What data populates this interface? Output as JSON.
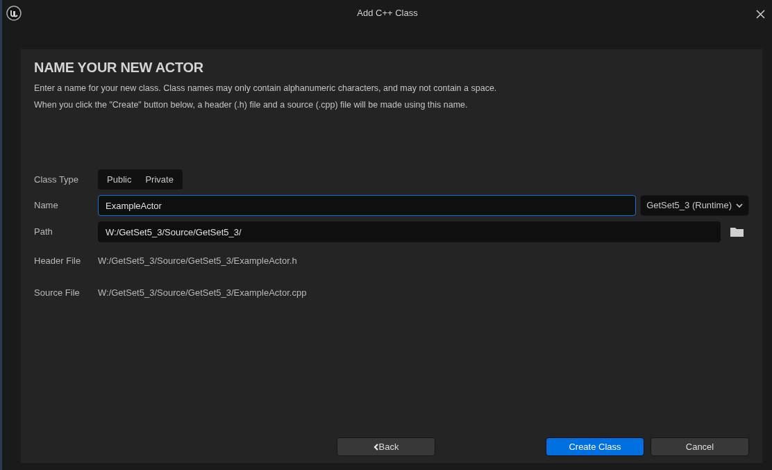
{
  "window": {
    "title": "Add C++ Class"
  },
  "heading": "NAME YOUR NEW ACTOR",
  "description": [
    "Enter a name for your new class. Class names may only contain alphanumeric characters, and may not contain a space.",
    "When you click the \"Create\" button below, a header (.h) file and a source (.cpp) file will be made using this name."
  ],
  "class_type": {
    "label": "Class Type",
    "options": [
      {
        "label": "Public",
        "selected": false
      },
      {
        "label": "Private",
        "selected": false
      }
    ]
  },
  "name": {
    "label": "Name",
    "value": "ExampleActor",
    "focused": true,
    "module": "GetSet5_3 (Runtime)"
  },
  "path": {
    "label": "Path",
    "value": "W:/GetSet5_3/Source/GetSet5_3/"
  },
  "header_file": {
    "label": "Header File",
    "value": "W:/GetSet5_3/Source/GetSet5_3/ExampleActor.h"
  },
  "source_file": {
    "label": "Source File",
    "value": "W:/GetSet5_3/Source/GetSet5_3/ExampleActor.cpp"
  },
  "buttons": [
    {
      "label": "Back",
      "kind": "back"
    },
    {
      "label": "Create Class",
      "kind": "primary"
    },
    {
      "label": "Cancel",
      "kind": "secondary"
    }
  ]
}
